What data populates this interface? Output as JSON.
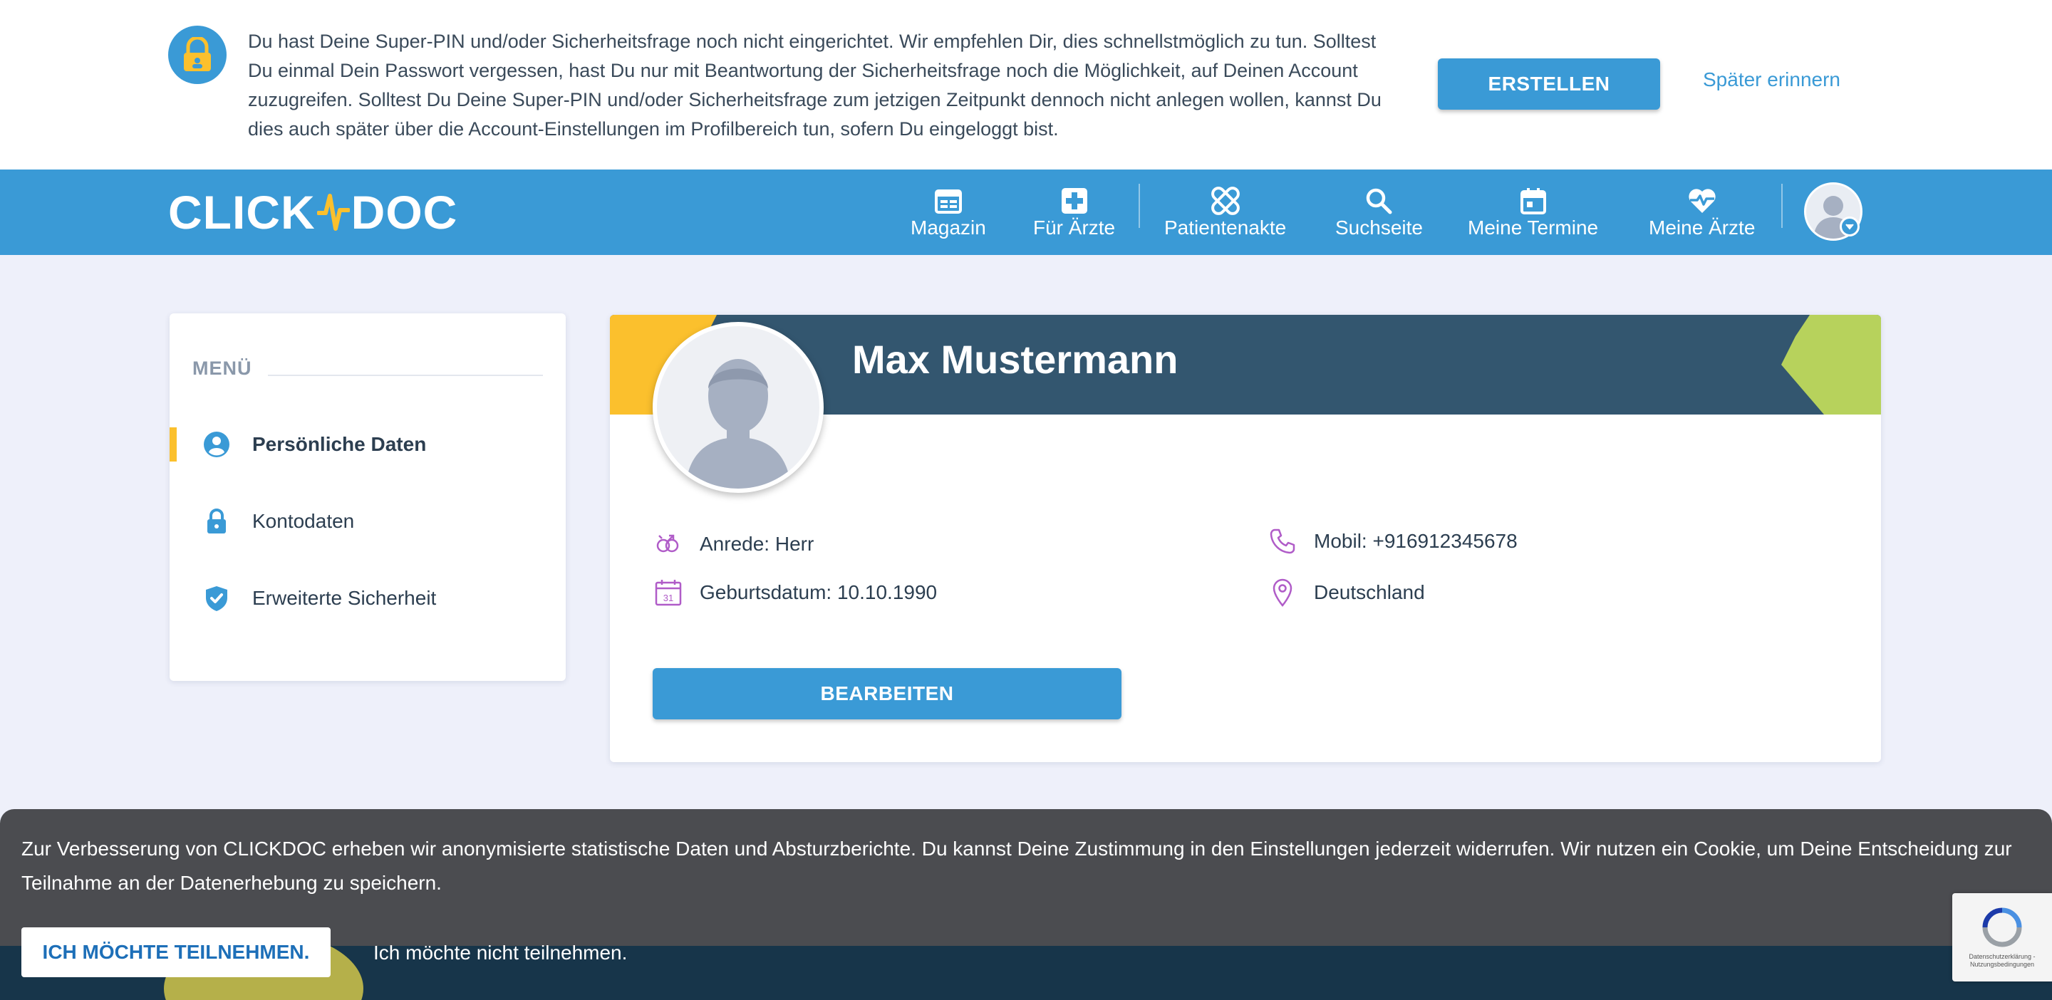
{
  "banner": {
    "text": "Du hast Deine Super-PIN und/oder Sicherheitsfrage noch nicht eingerichtet. Wir empfehlen Dir, dies schnellstmöglich zu tun. Solltest Du einmal Dein Passwort vergessen, hast Du nur mit Beantwortung der Sicherheitsfrage noch die Möglichkeit, auf Deinen Account zuzugreifen. Solltest Du Deine Super-PIN und/oder Sicherheitsfrage zum jetzigen Zeitpunkt dennoch nicht anlegen wollen, kannst Du dies auch später über die Account-Einstellungen im Profilbereich tun, sofern Du eingeloggt bist.",
    "create_label": "ERSTELLEN",
    "later_label": "Später erinnern"
  },
  "nav": {
    "logo_left": "CLICK",
    "logo_right": "DOC",
    "items": [
      {
        "label": "Magazin",
        "icon": "magazine-icon"
      },
      {
        "label": "Für Ärzte",
        "icon": "medical-cross-icon"
      },
      {
        "label": "Patientenakte",
        "icon": "bandage-icon"
      },
      {
        "label": "Suchseite",
        "icon": "search-icon"
      },
      {
        "label": "Meine Termine",
        "icon": "calendar-icon"
      },
      {
        "label": "Meine Ärzte",
        "icon": "heart-pulse-icon"
      }
    ]
  },
  "sidebar": {
    "title": "MENÜ",
    "items": [
      {
        "label": "Persönliche Daten",
        "icon": "user-circle-icon",
        "active": true
      },
      {
        "label": "Kontodaten",
        "icon": "lock-icon",
        "active": false
      },
      {
        "label": "Erweiterte Sicherheit",
        "icon": "shield-check-icon",
        "active": false
      }
    ]
  },
  "profile": {
    "name": "Max Mustermann",
    "salutation": "Anrede: Herr",
    "birthdate": "Geburtsdatum: 10.10.1990",
    "birthdate_icon_day": "31",
    "mobile": "Mobil: +916912345678",
    "country": "Deutschland",
    "edit_label": "BEARBEITEN"
  },
  "cookie": {
    "text": "Zur Verbesserung von CLICKDOC erheben wir anonymisierte statistische Daten und Absturzberichte. Du kannst Deine Zustimmung in den Einstellungen jederzeit widerrufen. Wir nutzen ein Cookie, um Deine Entscheidung zur Teilnahme an der Datenerhebung zu speichern.",
    "accept_label": "ICH MÖCHTE TEILNEHMEN.",
    "decline_label": "Ich möchte nicht teilnehmen."
  },
  "recaptcha": {
    "text": "Datenschutzerklärung - Nutzungsbedingungen"
  },
  "colors": {
    "primary": "#3a9ad6",
    "header_dark": "#33566f",
    "accent_yellow": "#fbc02d",
    "accent_green": "#b7d25c",
    "icon_purple": "#b05cc8"
  }
}
